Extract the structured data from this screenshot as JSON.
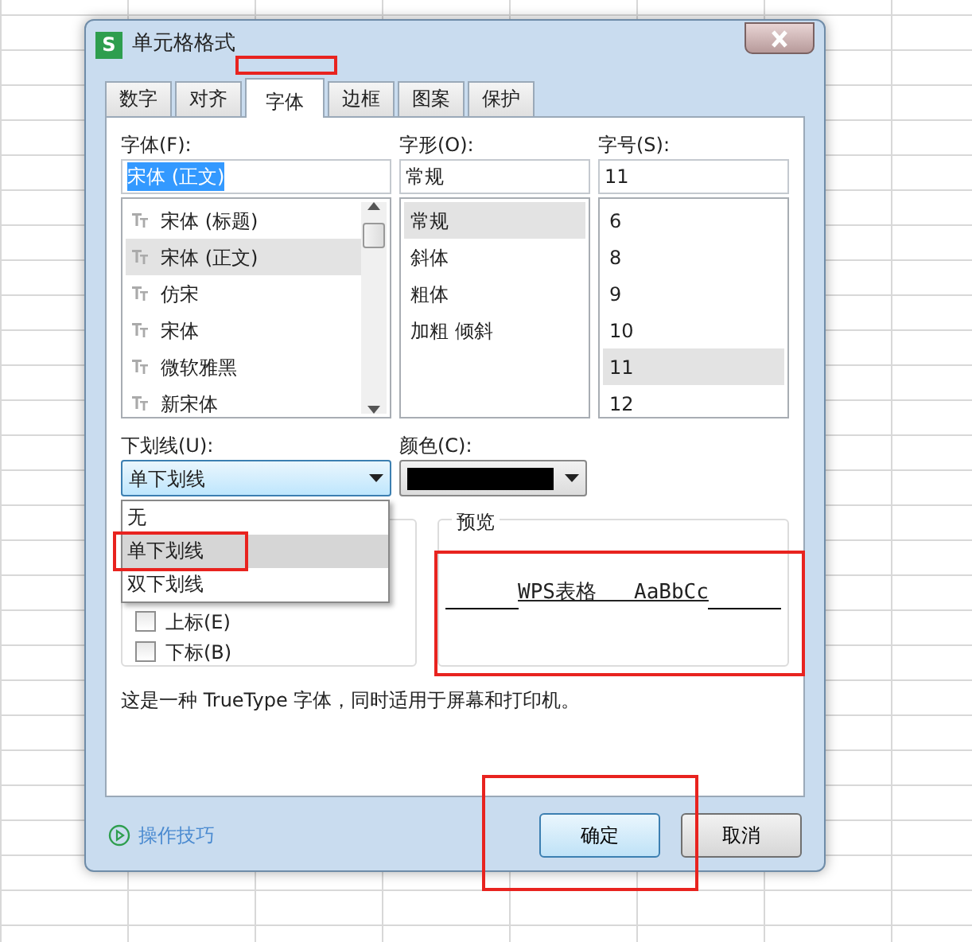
{
  "window": {
    "title": "单元格格式",
    "app_icon": "S"
  },
  "tabs": [
    {
      "label": "数字",
      "selected": false,
      "annotated": false
    },
    {
      "label": "对齐",
      "selected": false,
      "annotated": false
    },
    {
      "label": "字体",
      "selected": true,
      "annotated": true
    },
    {
      "label": "边框",
      "selected": false,
      "annotated": false
    },
    {
      "label": "图案",
      "selected": false,
      "annotated": false
    },
    {
      "label": "保护",
      "selected": false,
      "annotated": false
    }
  ],
  "font": {
    "label": "字体(F):",
    "value": "宋体 (正文)",
    "value_highlighted": true,
    "items": [
      {
        "label": "宋体 (标题)",
        "selected": false
      },
      {
        "label": "宋体 (正文)",
        "selected": true
      },
      {
        "label": "仿宋",
        "selected": false
      },
      {
        "label": "宋体",
        "selected": false
      },
      {
        "label": "微软雅黑",
        "selected": false
      },
      {
        "label": "新宋体",
        "selected": false
      }
    ]
  },
  "style": {
    "label": "字形(O):",
    "value": "常规",
    "items": [
      {
        "label": "常规",
        "selected": true
      },
      {
        "label": "斜体",
        "selected": false
      },
      {
        "label": "粗体",
        "selected": false
      },
      {
        "label": "加粗 倾斜",
        "selected": false
      }
    ]
  },
  "size": {
    "label": "字号(S):",
    "value": "11",
    "items": [
      {
        "label": "6",
        "selected": false
      },
      {
        "label": "8",
        "selected": false
      },
      {
        "label": "9",
        "selected": false
      },
      {
        "label": "10",
        "selected": false
      },
      {
        "label": "11",
        "selected": true
      },
      {
        "label": "12",
        "selected": false
      }
    ]
  },
  "underline": {
    "label": "下划线(U):",
    "value": "单下划线",
    "expanded": true,
    "options": [
      {
        "label": "无",
        "selected": false,
        "annotated": false
      },
      {
        "label": "单下划线",
        "selected": true,
        "annotated": true
      },
      {
        "label": "双下划线",
        "selected": false,
        "annotated": false
      }
    ]
  },
  "color": {
    "label": "颜色(C):",
    "color": "#000000"
  },
  "effects": [
    {
      "label": "上标(E)",
      "checked": false
    },
    {
      "label": "下标(B)",
      "checked": false
    }
  ],
  "preview": {
    "title": "预览",
    "text": "WPS表格   AaBbCc",
    "annotated": true
  },
  "description": "这是一种 TrueType 字体，同时适用于屏幕和打印机。",
  "tips_link": "操作技巧",
  "buttons": [
    {
      "label": "确定",
      "default": true,
      "annotated": true
    },
    {
      "label": "取消",
      "default": false,
      "annotated": false
    }
  ]
}
